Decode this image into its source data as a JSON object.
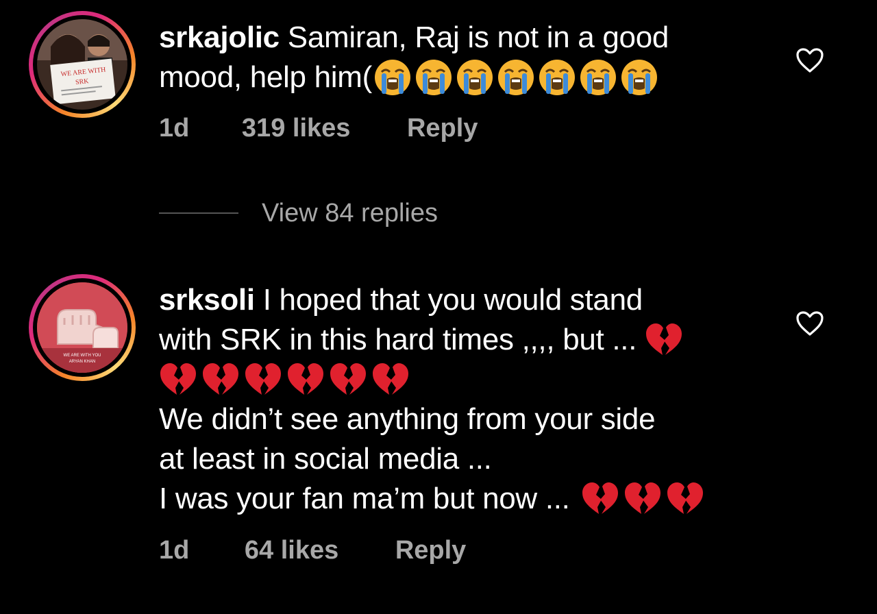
{
  "comments": [
    {
      "username": "srkajolic",
      "line1": "Samiran, Raj is not in a good",
      "line2": "mood, help him(",
      "emoji_count": 7,
      "emoji": "loudly-crying-face",
      "time": "1d",
      "likes": "319 likes",
      "reply": "Reply",
      "avatar_text": [
        "WE ARE WITH",
        "SRK"
      ]
    },
    {
      "username": "srksoli",
      "line1": "I hoped that you would stand",
      "line2": "with SRK in this hard times ,,,, but ...",
      "line4": "We didn’t see anything  from your side",
      "line5": "at least in social media ...",
      "line6": "I was your fan ma’m but now ...",
      "emoji": "broken-heart",
      "time": "1d",
      "likes": "64 likes",
      "reply": "Reply",
      "avatar_text": [
        "WE ARE WITH YOU",
        "ARYAN KHAN"
      ]
    }
  ],
  "view_replies": "View 84 replies",
  "colors": {
    "background": "#000000",
    "text": "#ffffff",
    "meta": "#a8a8a8",
    "broken_heart": "#e0212e",
    "emoji_yellow": "#f7b531",
    "tears": "#3d8bd9"
  }
}
